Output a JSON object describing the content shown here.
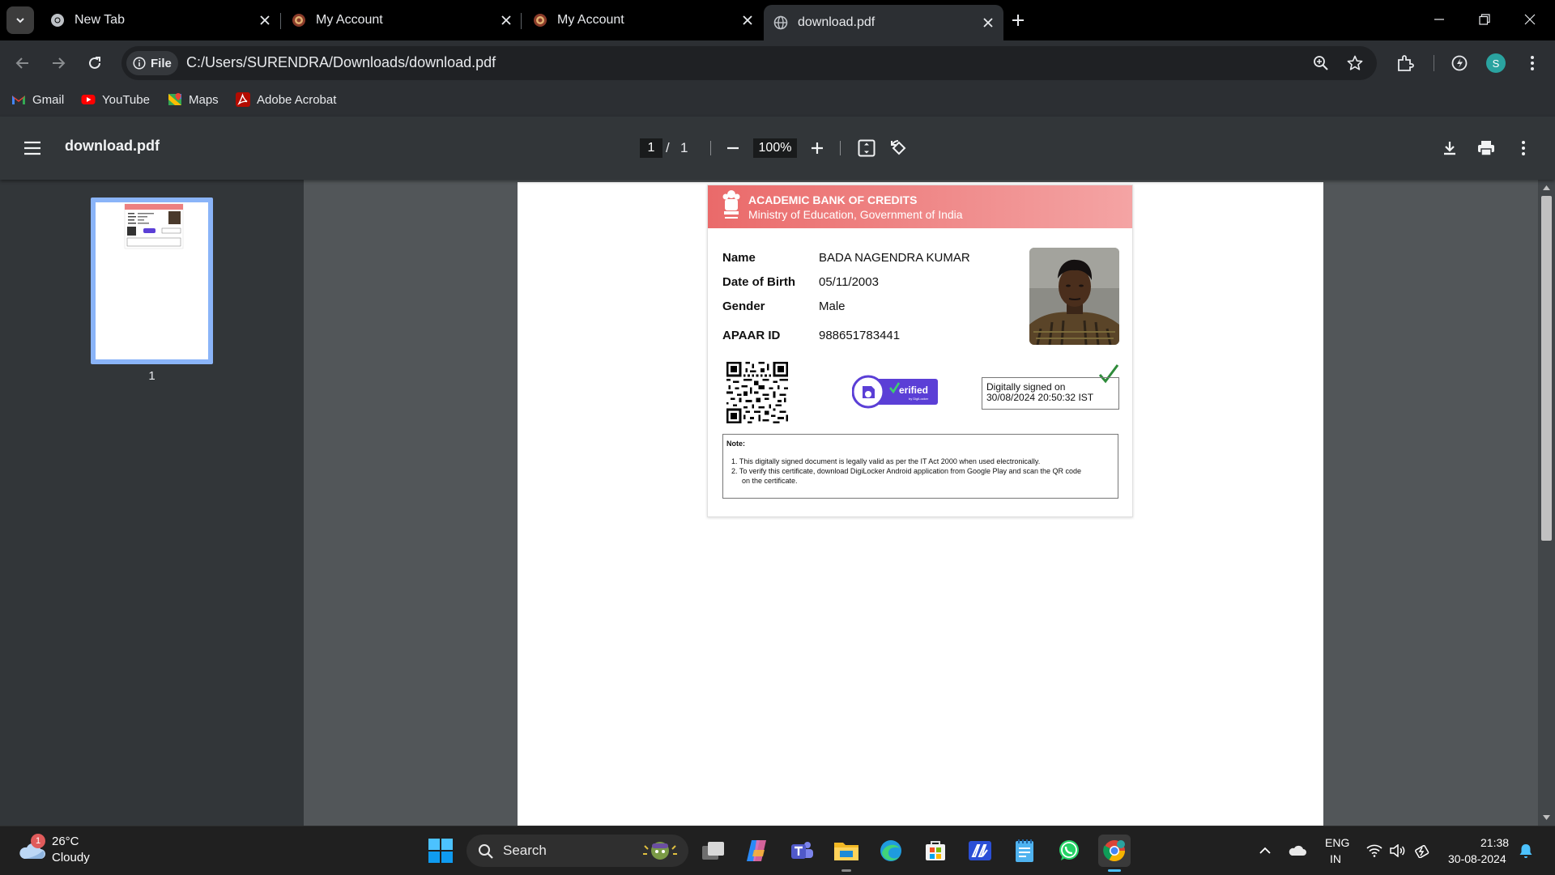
{
  "tabs": [
    {
      "title": "New Tab",
      "icon": "chrome-icon",
      "active": false
    },
    {
      "title": "My Account",
      "icon": "university-logo-icon",
      "active": false
    },
    {
      "title": "My Account",
      "icon": "university-logo-icon",
      "active": false
    },
    {
      "title": "download.pdf",
      "icon": "globe-icon",
      "active": true
    }
  ],
  "address_bar": {
    "scheme_chip": "File",
    "url": "C:/Users/SURENDRA/Downloads/download.pdf"
  },
  "profile": {
    "initial": "S"
  },
  "bookmarks": [
    {
      "label": "Gmail",
      "icon": "gmail-icon"
    },
    {
      "label": "YouTube",
      "icon": "youtube-icon"
    },
    {
      "label": "Maps",
      "icon": "maps-icon"
    },
    {
      "label": "Adobe Acrobat",
      "icon": "acrobat-icon"
    }
  ],
  "pdf_viewer": {
    "title": "download.pdf",
    "current_page": "1",
    "page_separator": "/",
    "total_pages": "1",
    "zoom": "100%",
    "thumbnail_label": "1"
  },
  "document": {
    "org_name": "ACADEMIC BANK OF CREDITS",
    "ministry": "Ministry of Education, Government of India",
    "fields": [
      {
        "label": "Name",
        "value": "BADA NAGENDRA KUMAR"
      },
      {
        "label": "Date of Birth",
        "value": "05/11/2003"
      },
      {
        "label": "Gender",
        "value": "Male"
      },
      {
        "label": "APAAR ID",
        "value": "988651783441"
      }
    ],
    "verified_text": "erified",
    "verified_by": "by DigiLocker",
    "signed_line1": "Digitally signed on",
    "signed_line2": "30/08/2024 20:50:32 IST",
    "note_title": "Note:",
    "notes": [
      "1.  This digitally signed document is legally valid as per the IT Act 2000 when used electronically.",
      "2.  To verify this certificate, download DigiLocker Android application from Google Play and scan the QR code",
      "on the certificate."
    ]
  },
  "taskbar": {
    "weather_badge": "1",
    "temperature": "26°C",
    "condition": "Cloudy",
    "search_label": "Search",
    "language_line1": "ENG",
    "language_line2": "IN",
    "time": "21:38",
    "date": "30-08-2024"
  },
  "colors": {
    "card_header_start": "#ea6a6a",
    "card_header_end": "#f4a4a4",
    "verified_purple": "#5b3fd6",
    "check_green": "#2e8b3a",
    "thumbnail_highlight": "#8ab4f8"
  }
}
